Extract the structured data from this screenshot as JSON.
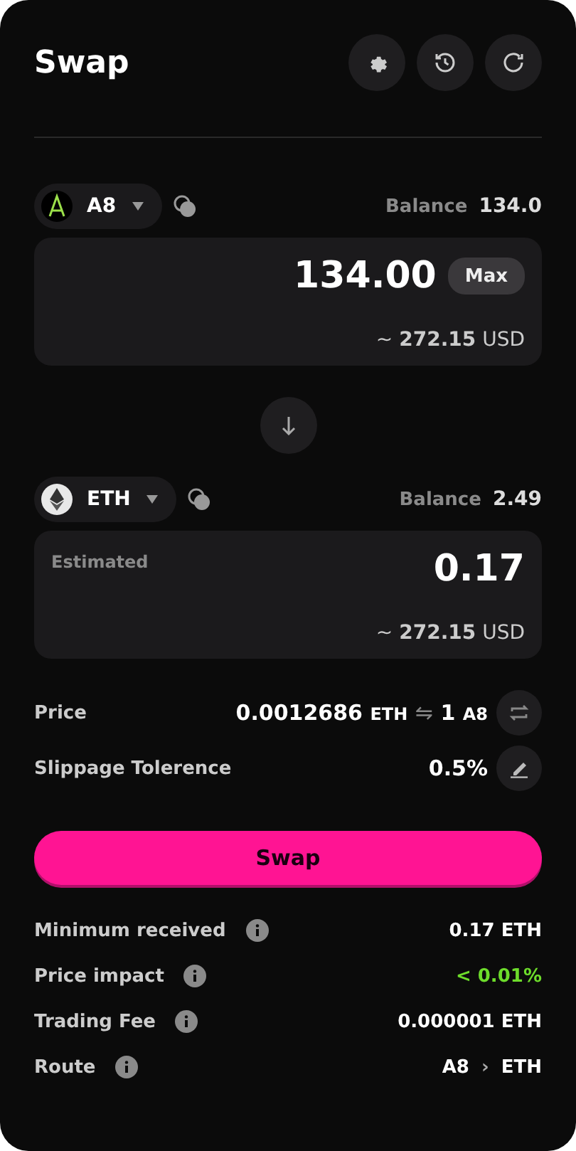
{
  "title": "Swap",
  "from": {
    "token": "A8",
    "balance_label": "Balance",
    "balance": "134.0",
    "amount": "134.00",
    "max": "Max",
    "usd_prefix": "~",
    "usd_value": "272.15",
    "usd_unit": "USD"
  },
  "to": {
    "token": "ETH",
    "balance_label": "Balance",
    "balance": "2.49",
    "hint": "Estimated",
    "amount": "0.17",
    "usd_prefix": "~",
    "usd_value": "272.15",
    "usd_unit": "USD"
  },
  "price": {
    "label": "Price",
    "value": "0.0012686",
    "unit": "ETH",
    "sep": "⇋",
    "value2": "1",
    "unit2": "A8"
  },
  "slippage": {
    "label": "Slippage Tolerence",
    "value": "0.5%"
  },
  "swap_button": "Swap",
  "details": [
    {
      "label": "Minimum received",
      "value": "0.17 ETH",
      "highlight": false
    },
    {
      "label": "Price impact",
      "value": "< 0.01%",
      "highlight": true
    },
    {
      "label": "Trading Fee",
      "value": "0.000001 ETH",
      "highlight": false
    }
  ],
  "route": {
    "label": "Route",
    "from": "A8",
    "sep": "›",
    "to": "ETH"
  }
}
